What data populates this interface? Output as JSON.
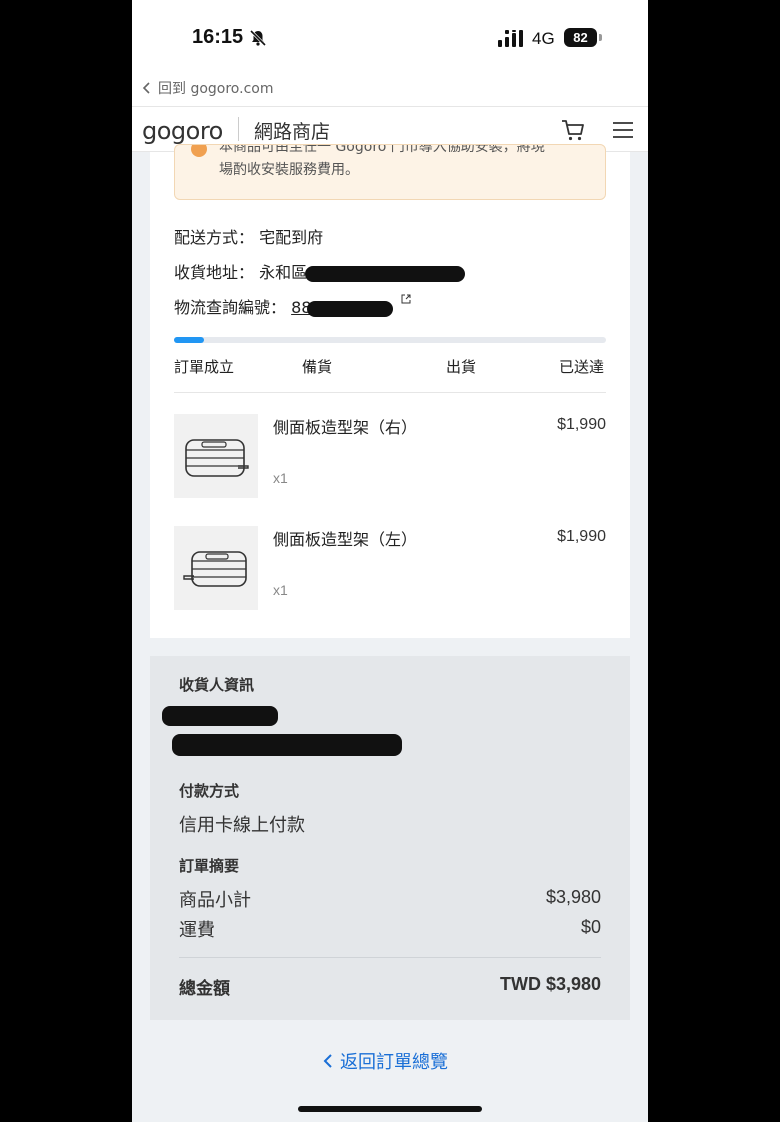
{
  "status_bar": {
    "time": "16:15",
    "network": "4G",
    "battery": "82",
    "icons": [
      "bell-slash-icon",
      "signal-icon",
      "battery-icon"
    ]
  },
  "back_bar": {
    "label": "回到 gogoro.com"
  },
  "header": {
    "logo": "gogoro",
    "store_name": "網路商店",
    "icons": [
      "cart-icon",
      "menu-icon"
    ]
  },
  "notice": {
    "line1": "本商品可由至任一 Gogoro 門市導入協助安裝，將現",
    "line2": "場酌收安裝服務費用。"
  },
  "shipping": {
    "method_label": "配送方式：",
    "method_value": "宅配到府",
    "address_label": "收貨地址：",
    "address_visible": "永和區",
    "tracking_label": "物流查詢編號：",
    "tracking_visible": "88"
  },
  "progress": {
    "steps": [
      "訂單成立",
      "備貨",
      "出貨",
      "已送達"
    ],
    "fill_fraction": 0.07
  },
  "items": [
    {
      "name": "側面板造型架（右）",
      "price": "$1,990",
      "qty": "x1"
    },
    {
      "name": "側面板造型架（左）",
      "price": "$1,990",
      "qty": "x1"
    }
  ],
  "summary": {
    "recipient_heading": "收貨人資訊",
    "payment_heading": "付款方式",
    "payment_value": "信用卡線上付款",
    "order_summary_heading": "訂單摘要",
    "subtotal_label": "商品小計",
    "subtotal_value": "$3,980",
    "shipping_label": "運費",
    "shipping_value": "$0",
    "total_label": "總金額",
    "total_value": "TWD $3,980"
  },
  "return_link": {
    "label": "返回訂單總覽"
  },
  "colors": {
    "accent": "#1a6fd6",
    "progress": "#2196f3",
    "notice_bg": "#fdf3e6",
    "summary_bg": "#e4e7ea"
  }
}
